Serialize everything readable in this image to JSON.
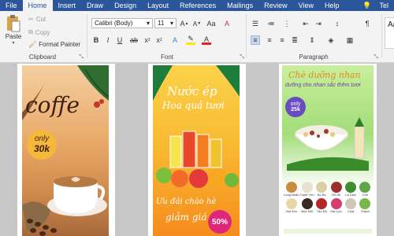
{
  "tabs": [
    "File",
    "Home",
    "Insert",
    "Draw",
    "Design",
    "Layout",
    "References",
    "Mailings",
    "Review",
    "View",
    "Help"
  ],
  "tab_cut": "Tel",
  "clipboard": {
    "paste": "Paste",
    "cut": "Cut",
    "copy": "Copy",
    "format_painter": "Format Painter",
    "label": "Clipboard"
  },
  "font": {
    "name": "Calibri (Body)",
    "size": "11",
    "label": "Font"
  },
  "paragraph": {
    "label": "Paragraph"
  },
  "styles": {
    "preview": "Aa"
  },
  "posters": {
    "coffee": {
      "title": "coffe",
      "badge_line1": "only",
      "badge_line2": "30k"
    },
    "juice": {
      "title_line1": "Nước ép",
      "title_line2": "Hoa quả tươi",
      "promo_line1": "Ưu đãi chào hè",
      "promo_line2": "giảm giá",
      "discount": "50%"
    },
    "che": {
      "title": "Chè dưỡng nhan",
      "subtitle": "dưỡng cho nhan sắc thêm tươi",
      "badge_line1": "only",
      "badge_line2": "25k",
      "ingredients": [
        "Long Nhãn",
        "Tuyết Yến",
        "Bo Bo",
        "Đỗ đỏ",
        "Lá Dứa",
        "Chè",
        "Hạt Sen",
        "Mộc Nhĩ",
        "Táo Đỏ",
        "Hạt Lựu",
        "Chia",
        "Thạch"
      ]
    }
  },
  "colors": {
    "accent": "#2b579a",
    "coffee_bg": "#e9b07a",
    "juice_bg": "#f7b02a",
    "che_bg": "#9fd874"
  }
}
